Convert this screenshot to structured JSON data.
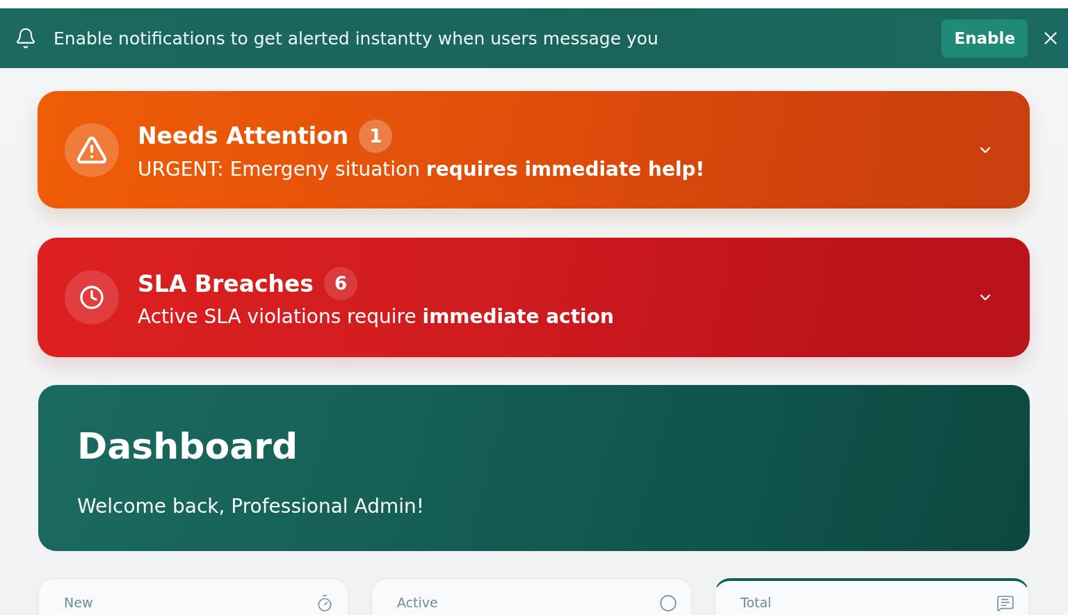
{
  "notification_bar": {
    "message": "Enable notifications to get alerted instantty when users message you",
    "button": "Enable"
  },
  "alerts": [
    {
      "kind": "attention",
      "title": "Needs Attention",
      "count": "1",
      "message": "URGENT: Emergeny situation **requires immediate help!**",
      "expanded": false
    },
    {
      "kind": "breach",
      "title": "SLA Breaches",
      "count": "6",
      "message": "Active SLA violations require **immediate action**",
      "expanded": false
    }
  ],
  "header": {
    "title": "Dashboard",
    "subtitle": "Welcome back, Professional Admin!"
  },
  "stats": [
    {
      "kind": "new",
      "label": "New",
      "selected": false
    },
    {
      "kind": "active",
      "label": "Active",
      "selected": false
    },
    {
      "kind": "total",
      "label": "Total",
      "selected": true
    }
  ]
}
